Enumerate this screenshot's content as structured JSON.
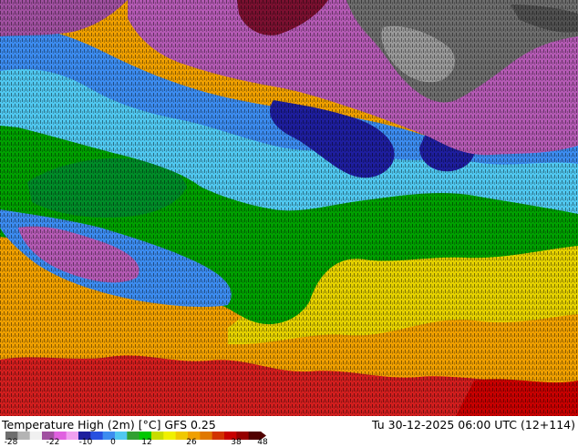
{
  "title": "Temperature High (2m) [°C] GFS 0.25",
  "valid_time": "Tu 30-12-2025 06:00 UTC (12+114)",
  "legend": {
    "ticks": [
      "-28",
      "-22",
      "-10",
      "0",
      "12",
      "26",
      "38",
      "48"
    ],
    "colors": [
      "#6e6e6e",
      "#b4b4b4",
      "#f0f0f0",
      "#a050a0",
      "#e060e0",
      "#f0a0f0",
      "#1e1e9e",
      "#2850e0",
      "#3c8cf0",
      "#50c8f0",
      "#32a032",
      "#00c800",
      "#c8dc00",
      "#f0f000",
      "#f0c800",
      "#f0a000",
      "#e07800",
      "#d23200",
      "#c80000",
      "#960000",
      "#500000"
    ]
  },
  "regions": [
    {
      "name": "gray-cold-region",
      "color": "#6e6e6e"
    },
    {
      "name": "magenta-region",
      "color": "#a050a0"
    },
    {
      "name": "blue-region",
      "color": "#3c8cf0"
    },
    {
      "name": "cyan-region",
      "color": "#50c8f0"
    },
    {
      "name": "green-region",
      "color": "#00a000"
    },
    {
      "name": "yellow-region",
      "color": "#e6d200"
    },
    {
      "name": "orange-region",
      "color": "#f0a000"
    },
    {
      "name": "red-region",
      "color": "#d21e1e"
    }
  ]
}
